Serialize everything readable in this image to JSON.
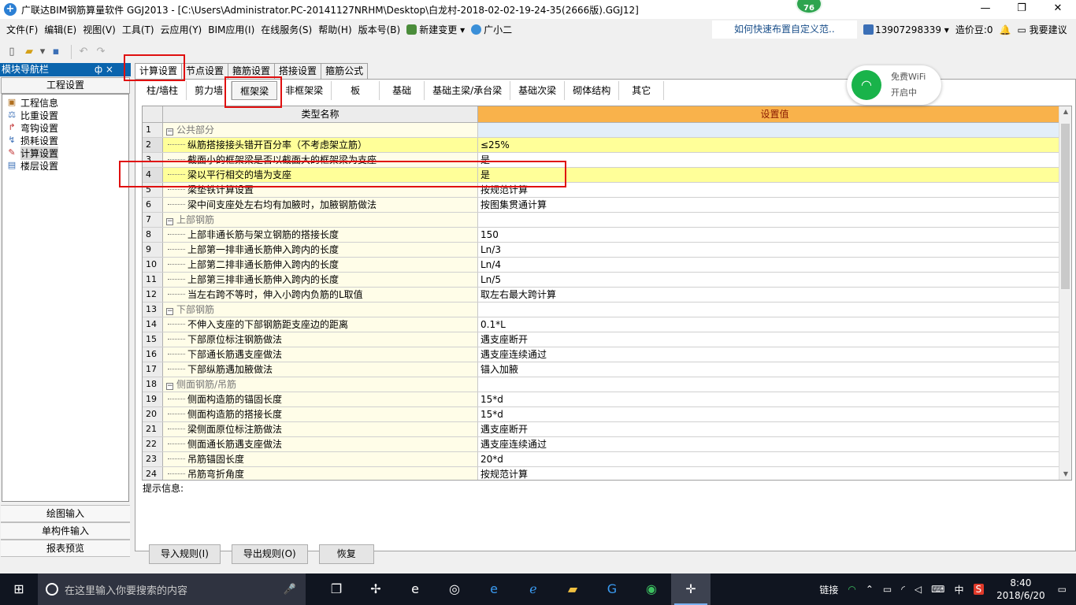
{
  "title_bar": {
    "title": "广联达BIM钢筋算量软件 GGJ2013 - [C:\\Users\\Administrator.PC-20141127NRHM\\Desktop\\白龙村-2018-02-02-19-24-35(2666版).GGJ12]",
    "score": "76",
    "minimize": "—",
    "restore": "❐",
    "close": "✕"
  },
  "menu": {
    "items": [
      "文件(F)",
      "编辑(E)",
      "视图(V)",
      "工具(T)",
      "云应用(Y)",
      "BIM应用(I)",
      "在线服务(S)",
      "帮助(H)",
      "版本号(B)"
    ],
    "new_change": "新建变更",
    "assistant": "广小二",
    "tip_link": "如何快速布置自定义范..",
    "phone": "13907298339",
    "points": "造价豆:0",
    "suggest": "我要建议"
  },
  "left_panel": {
    "header": "模块导航栏",
    "pin": "ф ×",
    "section_title": "工程设置",
    "tree": [
      {
        "label": "工程信息",
        "icon": "folder-icon"
      },
      {
        "label": "比重设置",
        "icon": "weight-icon"
      },
      {
        "label": "弯钩设置",
        "icon": "hook-icon"
      },
      {
        "label": "损耗设置",
        "icon": "loss-icon"
      },
      {
        "label": "计算设置",
        "icon": "calc-icon"
      },
      {
        "label": "楼层设置",
        "icon": "floor-icon"
      }
    ],
    "bottom": [
      "绘图输入",
      "单构件输入",
      "报表预览"
    ]
  },
  "top_tabs": [
    "计算设置",
    "节点设置",
    "箍筋设置",
    "搭接设置",
    "箍筋公式"
  ],
  "sub_tabs": [
    "柱/墙柱",
    "剪力墙",
    "框架梁",
    "非框架梁",
    "板",
    "基础",
    "基础主梁/承台梁",
    "基础次梁",
    "砌体结构",
    "其它"
  ],
  "grid": {
    "col_name": "类型名称",
    "col_value": "设置值",
    "rows": [
      {
        "n": "1",
        "name": "公共部分",
        "value": "",
        "group": true
      },
      {
        "n": "2",
        "name": "纵筋搭接接头错开百分率（不考虑架立筋）",
        "value": "≤25%"
      },
      {
        "n": "3",
        "name": "截面小的框架梁是否以截面大的框架梁为支座",
        "value": "是"
      },
      {
        "n": "4",
        "name": "梁以平行相交的墙为支座",
        "value": "是"
      },
      {
        "n": "5",
        "name": "梁垫铁计算设置",
        "value": "按规范计算"
      },
      {
        "n": "6",
        "name": "梁中间支座处左右均有加腋时，加腋钢筋做法",
        "value": "按图集贯通计算"
      },
      {
        "n": "7",
        "name": "上部钢筋",
        "value": "",
        "group": true
      },
      {
        "n": "8",
        "name": "上部非通长筋与架立钢筋的搭接长度",
        "value": "150"
      },
      {
        "n": "9",
        "name": "上部第一排非通长筋伸入跨内的长度",
        "value": "Ln/3"
      },
      {
        "n": "10",
        "name": "上部第二排非通长筋伸入跨内的长度",
        "value": "Ln/4"
      },
      {
        "n": "11",
        "name": "上部第三排非通长筋伸入跨内的长度",
        "value": "Ln/5"
      },
      {
        "n": "12",
        "name": "当左右跨不等时，伸入小跨内负筋的L取值",
        "value": "取左右最大跨计算"
      },
      {
        "n": "13",
        "name": "下部钢筋",
        "value": "",
        "group": true
      },
      {
        "n": "14",
        "name": "不伸入支座的下部钢筋距支座边的距离",
        "value": "0.1*L"
      },
      {
        "n": "15",
        "name": "下部原位标注钢筋做法",
        "value": "遇支座断开"
      },
      {
        "n": "16",
        "name": "下部通长筋遇支座做法",
        "value": "遇支座连续通过"
      },
      {
        "n": "17",
        "name": "下部纵筋遇加腋做法",
        "value": "锚入加腋"
      },
      {
        "n": "18",
        "name": "侧面钢筋/吊筋",
        "value": "",
        "group": true
      },
      {
        "n": "19",
        "name": "侧面构造筋的锚固长度",
        "value": "15*d"
      },
      {
        "n": "20",
        "name": "侧面构造筋的搭接长度",
        "value": "15*d"
      },
      {
        "n": "21",
        "name": "梁侧面原位标注筋做法",
        "value": "遇支座断开"
      },
      {
        "n": "22",
        "name": "侧面通长筋遇支座做法",
        "value": "遇支座连续通过"
      },
      {
        "n": "23",
        "name": "吊筋锚固长度",
        "value": "20*d"
      },
      {
        "n": "24",
        "name": "吊筋弯折角度",
        "value": "按规范计算"
      }
    ]
  },
  "hint_label": "提示信息:",
  "buttons": {
    "import": "导入规则(I)",
    "export": "导出规则(O)",
    "restore": "恢复"
  },
  "wifi": {
    "line1": "免费WiFi",
    "line2": "开启中"
  },
  "taskbar": {
    "search_placeholder": "在这里输入你要搜索的内容",
    "link": "链接",
    "ime": "中",
    "time": "8:40",
    "date": "2018/6/20"
  }
}
